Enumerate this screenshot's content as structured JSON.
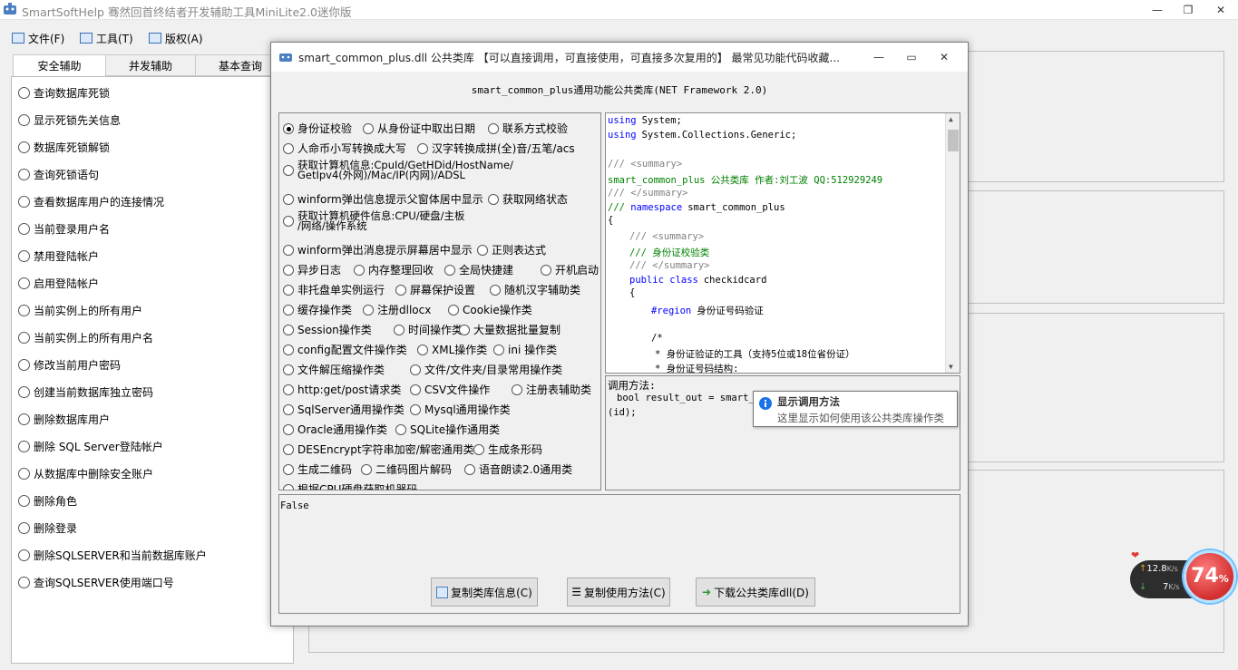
{
  "window": {
    "title": "SmartSoftHelp 骞然回首终结者开发辅助工具MiniLite2.0迷你版",
    "min": "—",
    "max": "❐",
    "close": "✕"
  },
  "menu": [
    {
      "label": "文件(F)"
    },
    {
      "label": "工具(T)"
    },
    {
      "label": "版权(A)"
    }
  ],
  "tabs": [
    {
      "label": "安全辅助"
    },
    {
      "label": "并发辅助"
    },
    {
      "label": "基本查询"
    }
  ],
  "left_items": [
    "查询数据库死锁",
    "显示死锁先关信息",
    "数据库死锁解锁",
    "查询死锁语句",
    "查看数据库用户的连接情况",
    "当前登录用户名",
    "禁用登陆帐户",
    "启用登陆帐户",
    "当前实例上的所有用户",
    "当前实例上的所有用户名",
    "修改当前用户密码",
    "创建当前数据库独立密码",
    "删除数据库用户",
    "删除 SQL Server登陆帐户",
    "从数据库中删除安全账户",
    "删除角色",
    "删除登录",
    "删除SQLSERVER和当前数据库账户",
    "查询SQLSERVER使用端口号"
  ],
  "dialog": {
    "title": "smart_common_plus.dll 公共类库 【可以直接调用，可直接使用，可直接多次复用的】 最常见功能代码收藏...",
    "min": "—",
    "max": "▭",
    "close": "✕",
    "subtitle": "smart_common_plus通用功能公共类库(NET Framework 2.0)",
    "options": [
      [
        "身份证校验",
        "从身份证中取出日期",
        "联系方式校验"
      ],
      [
        "人命币小写转换成大写",
        "汉字转换成拼(全)音/五笔/acs"
      ],
      [
        "获取计算机信息:CpuId/GetHDid/HostName/\nGetIpv4(外网)/Mac/IP(内网)/ADSL"
      ],
      [
        "winform弹出信息提示父窗体居中显示",
        "获取网络状态"
      ],
      [
        "获取计算机硬件信息:CPU/硬盘/主板\n/网络/操作系统"
      ],
      [
        "winform弹出消息提示屏幕居中显示",
        "正则表达式"
      ],
      [
        "异步日志",
        "内存整理回收",
        "全局快捷建",
        "开机启动"
      ],
      [
        "非托盘单实例运行",
        "屏幕保护设置",
        "随机汉字辅助类"
      ],
      [
        "缓存操作类",
        "注册dllocx",
        "Cookie操作类"
      ],
      [
        "Session操作类",
        "时间操作类",
        "大量数据批量复制"
      ],
      [
        "config配置文件操作类",
        "XML操作类",
        "ini 操作类"
      ],
      [
        "文件解压缩操作类",
        "文件/文件夹/目录常用操作类"
      ],
      [
        "http:get/post请求类",
        "CSV文件操作",
        "注册表辅助类"
      ],
      [
        "SqlServer通用操作类",
        "Mysql通用操作类"
      ],
      [
        "Oracle通用操作类",
        "SQLite操作通用类"
      ],
      [
        "DESEncrypt字符串加密/解密通用类",
        "生成条形码"
      ],
      [
        "生成二维码",
        "二维码图片解码",
        "语音朗读2.0通用类"
      ],
      [
        "根据CPU硬盘获取机器码"
      ]
    ],
    "code": [
      {
        "t": "kw",
        "s": "using"
      },
      {
        "t": "n",
        "s": "System;"
      },
      {
        "t": "kw",
        "s": "using"
      },
      {
        "t": "n",
        "s": "System.Collections.Generic;"
      },
      {
        "t": "gr",
        "s": "/// <summary>"
      },
      {
        "t": "cm",
        "s": "smart_common_plus 公共类库 作者:刘工波 QQ:512929249"
      },
      {
        "t": "gr",
        "s": "/// </summary>"
      },
      {
        "t": "kw",
        "s": "namespace"
      },
      {
        "t": "n",
        "s": "smart_common_plus"
      },
      {
        "t": "n",
        "s": "{"
      },
      {
        "t": "gr",
        "s": "/// <summary>"
      },
      {
        "t": "cm",
        "s": "/// 身份证校验类"
      },
      {
        "t": "gr",
        "s": "/// </summary>"
      },
      {
        "t": "kw",
        "s": "public class"
      },
      {
        "t": "n",
        "s": "checkidcard"
      },
      {
        "t": "n",
        "s": "{"
      },
      {
        "t": "kw",
        "s": "#region"
      },
      {
        "t": "n",
        "s": "身份证号码验证"
      },
      {
        "t": "n",
        "s": "/*"
      },
      {
        "t": "n",
        "s": "* 身份证验证的工具（支持5位或18位省份证）"
      },
      {
        "t": "n",
        "s": "* 身份证号码结构:"
      }
    ],
    "usage_label": "调用方法:",
    "usage_line1": "bool result_out = smart_c",
    "usage_line2": "(id);",
    "output": "False",
    "buttons": [
      {
        "label": "复制类库信息(C)"
      },
      {
        "label": "复制使用方法(C)"
      },
      {
        "label": "下载公共类库dll(D)"
      }
    ]
  },
  "tooltip": {
    "title": "显示调用方法",
    "body": "这里显示如何使用该公共类库操作类"
  },
  "net_widget": {
    "up": "12.8",
    "up_unit": "K/s",
    "down": "7",
    "down_unit": "K/s",
    "percent": "74",
    "percent_sign": "%"
  },
  "colors": {
    "accent": "#3b6fb6",
    "comment": "#008000",
    "keyword": "#0000ff"
  }
}
